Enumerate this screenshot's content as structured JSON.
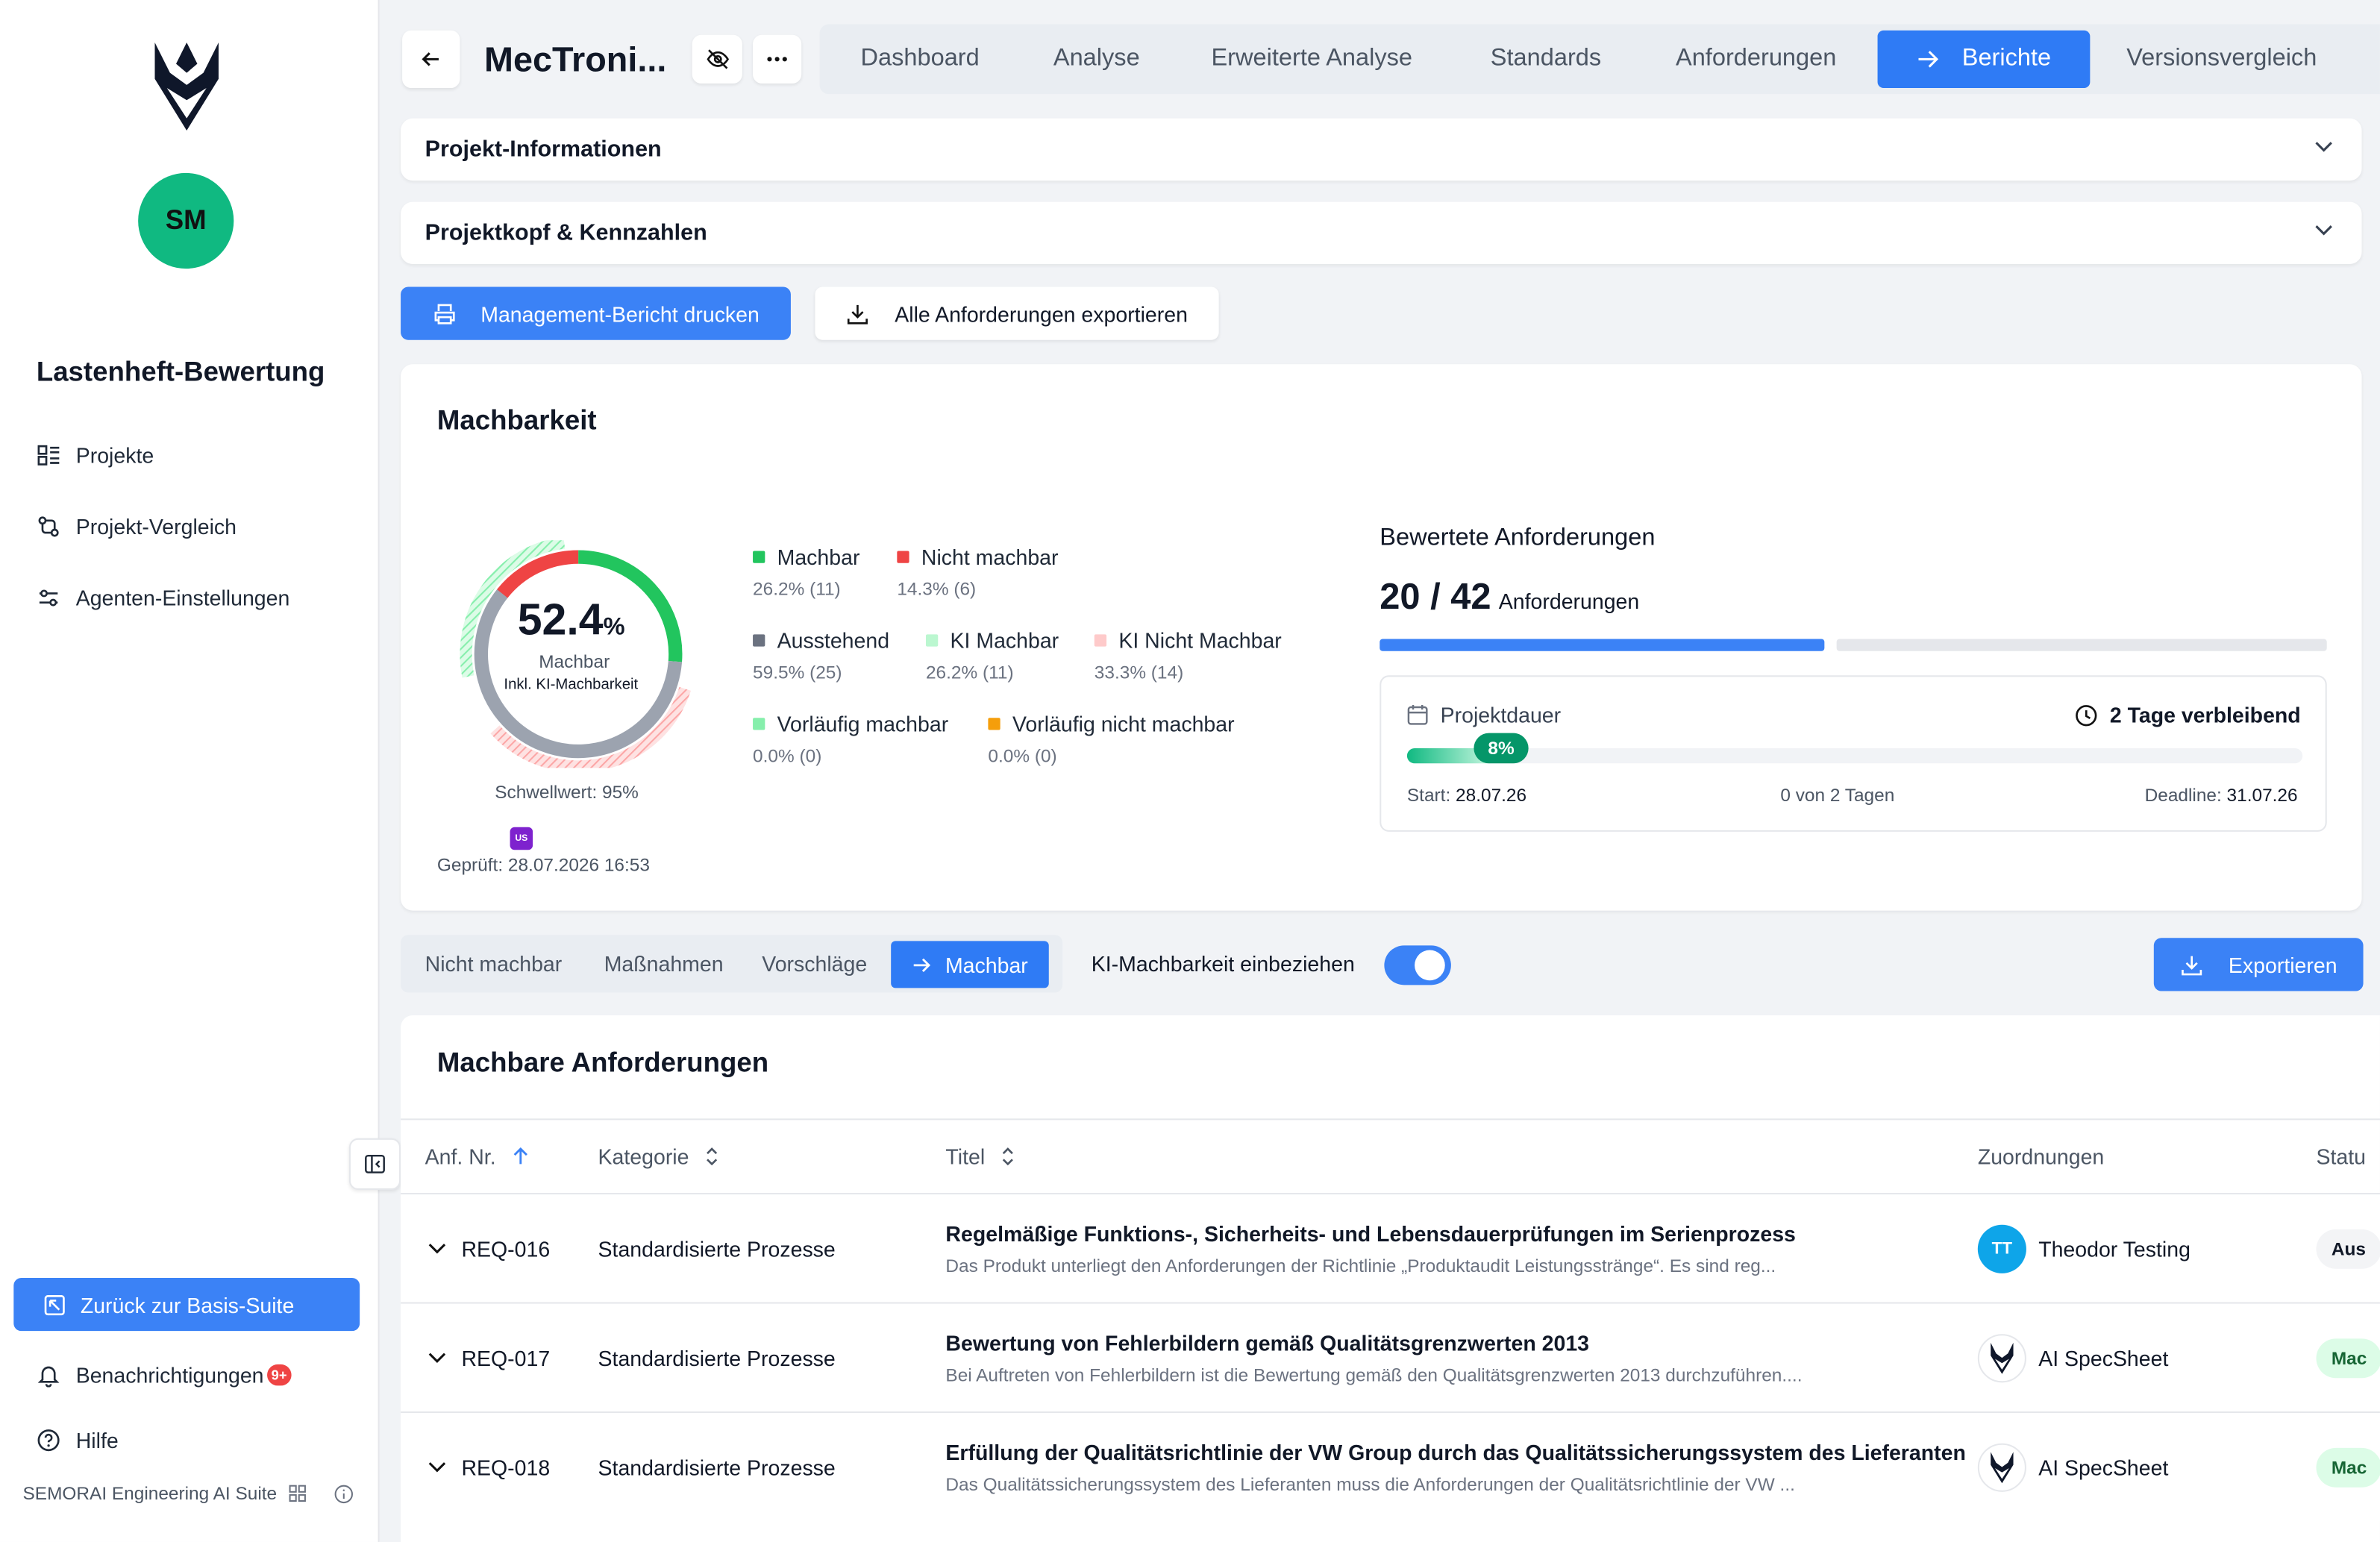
{
  "sidebar": {
    "avatar_initials": "SM",
    "app_title": "Lastenheft-Bewertung",
    "items": [
      {
        "label": "Projekte",
        "icon": "list-icon"
      },
      {
        "label": "Projekt-Vergleich",
        "icon": "compare-icon"
      },
      {
        "label": "Agenten-Einstellungen",
        "icon": "settings-sliders-icon"
      }
    ],
    "back_button": "Zurück zur Basis-Suite",
    "notifications_label": "Benachrichtigungen",
    "notifications_badge": "9+",
    "help_label": "Hilfe",
    "footer_label": "SEMORAI Engineering AI Suite"
  },
  "header": {
    "project_title": "MecTroni...",
    "tabs": [
      {
        "label": "Dashboard",
        "active": false
      },
      {
        "label": "Analyse",
        "active": false
      },
      {
        "label": "Erweiterte Analyse",
        "active": false
      },
      {
        "label": "Standards",
        "active": false
      },
      {
        "label": "Anforderungen",
        "active": false
      },
      {
        "label": "Berichte",
        "active": true
      },
      {
        "label": "Versionsvergleich",
        "active": false
      }
    ]
  },
  "sections": {
    "project_info": "Projekt-Informationen",
    "project_head": "Projektkopf & Kennzahlen"
  },
  "actions": {
    "print_report": "Management-Bericht drucken",
    "export_all": "Alle Anforderungen exportieren"
  },
  "feasibility": {
    "title": "Machbarkeit",
    "percent_value": "52.4",
    "percent_unit": "%",
    "center_label": "Machbar",
    "center_sub": "Inkl. KI-Machbarkeit",
    "threshold": "Schwellwert: 95%",
    "checker_badge": "US",
    "checked": "Geprüft: 28.07.2026 16:53",
    "gauge": {
      "inner_green_fraction": 0.262,
      "inner_red_fraction": 0.143,
      "inner_gray_fraction": 0.595,
      "outer_green_fraction": 0.262,
      "outer_red_fraction": 0.333
    },
    "legend": [
      {
        "label": "Machbar",
        "value": "26.2% (11)",
        "color": "#22c55e"
      },
      {
        "label": "Nicht machbar",
        "value": "14.3% (6)",
        "color": "#ef4444"
      },
      {
        "label": "Ausstehend",
        "value": "59.5% (25)",
        "color": "#6b7280"
      },
      {
        "label": "KI Machbar",
        "value": "26.2% (11)",
        "color": "#bbf7d0"
      },
      {
        "label": "KI Nicht Machbar",
        "value": "33.3% (14)",
        "color": "#fecaca"
      },
      {
        "label": "Vorläufig machbar",
        "value": "0.0% (0)",
        "color": "#86efac"
      },
      {
        "label": "Vorläufig nicht machbar",
        "value": "0.0% (0)",
        "color": "#f59e0b"
      }
    ]
  },
  "evaluated": {
    "title": "Bewertete Anforderungen",
    "count": "20 / 42",
    "count_label": "Anforderungen",
    "progress_fraction": 0.476,
    "duration_label": "Projektdauer",
    "remaining": "2 Tage verbleibend",
    "duration_percent": "8%",
    "duration_fraction": 0.08,
    "start_label": "Start:",
    "start_date": "28.07.26",
    "days_progress": "0 von 2 Tagen",
    "deadline_label": "Deadline:",
    "deadline_date": "31.07.26"
  },
  "subtabs": [
    {
      "label": "Nicht machbar",
      "active": false
    },
    {
      "label": "Maßnahmen",
      "active": false
    },
    {
      "label": "Vorschläge",
      "active": false
    },
    {
      "label": "Machbar",
      "active": true
    }
  ],
  "toggle": {
    "label": "KI-Machbarkeit einbeziehen",
    "on": true
  },
  "export_button": "Exportieren",
  "table": {
    "title": "Machbare Anforderungen",
    "columns": [
      "Anf. Nr.",
      "Kategorie",
      "Titel",
      "Zuordnungen",
      "Statu"
    ],
    "rows": [
      {
        "id": "REQ-016",
        "category": "Standardisierte Prozesse",
        "title": "Regelmäßige Funktions-, Sicherheits- und Lebensdauerprüfungen im Serienprozess",
        "desc": "Das Produkt unterliegt den Anforderungen der Richtlinie „Produktaudit Leistungsstränge“. Es sind reg...",
        "assignee": "Theodor Testing",
        "assignee_initials": "TT",
        "status": "Aus"
      },
      {
        "id": "REQ-017",
        "category": "Standardisierte Prozesse",
        "title": "Bewertung von Fehlerbildern gemäß Qualitätsgrenzwerten 2013",
        "desc": "Bei Auftreten von Fehlerbildern ist die Bewertung gemäß den Qualitätsgrenzwerten 2013 durchzuführen....",
        "assignee": "AI SpecSheet",
        "assignee_initials": "",
        "status": "Mac"
      },
      {
        "id": "REQ-018",
        "category": "Standardisierte Prozesse",
        "title": "Erfüllung der Qualitätsrichtlinie der VW Group durch das Qualitätssicherungssystem des Lieferanten",
        "desc": "Das Qualitätssicherungssystem des Lieferanten muss die Anforderungen der Qualitätsrichtlinie der VW ...",
        "assignee": "AI SpecSheet",
        "assignee_initials": "",
        "status": "Mac"
      }
    ]
  }
}
